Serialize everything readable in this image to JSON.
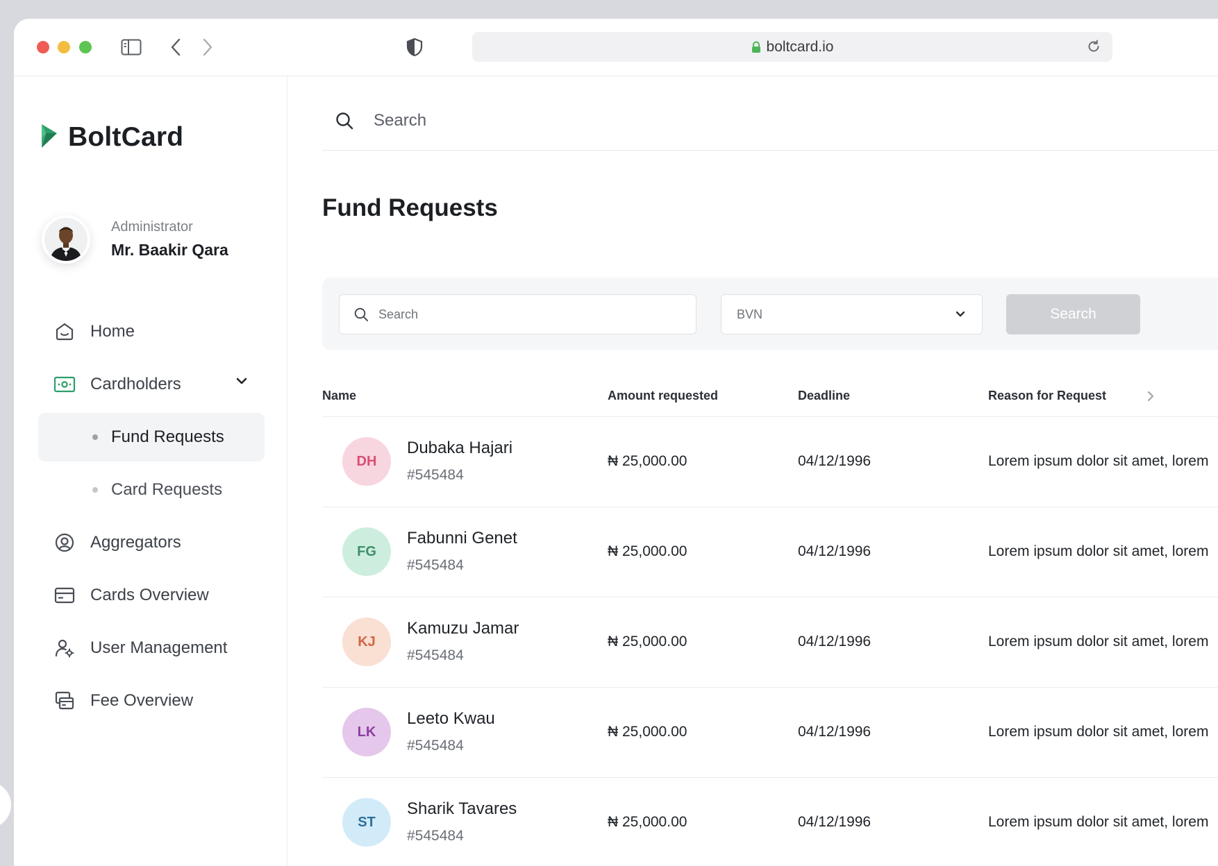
{
  "browser": {
    "url": "boltcard.io"
  },
  "brand": {
    "name": "BoltCard",
    "accent": "#2e9e6b"
  },
  "profile": {
    "role": "Administrator",
    "name": "Mr. Baakir Qara"
  },
  "nav": {
    "home": "Home",
    "cardholders": "Cardholders",
    "fund_requests": "Fund Requests",
    "card_requests": "Card Requests",
    "aggregators": "Aggregators",
    "cards_overview": "Cards Overview",
    "user_management": "User Management",
    "fee_overview": "Fee Overview"
  },
  "topbar": {
    "search_placeholder": "Search"
  },
  "page": {
    "title": "Fund Requests"
  },
  "filters": {
    "search_placeholder": "Search",
    "select_value": "BVN",
    "button_label": "Search"
  },
  "table": {
    "columns": {
      "name": "Name",
      "amount": "Amount requested",
      "deadline": "Deadline",
      "reason": "Reason for Request"
    },
    "rows": [
      {
        "initials": "DH",
        "name": "Dubaka Hajari",
        "id": "#545484",
        "amount": "₦ 25,000.00",
        "deadline": "04/12/1996",
        "reason": "Lorem ipsum dolor sit amet, lorem",
        "avatar_bg": "#f8d6df",
        "avatar_fg": "#d94f74"
      },
      {
        "initials": "FG",
        "name": "Fabunni Genet",
        "id": "#545484",
        "amount": "₦ 25,000.00",
        "deadline": "04/12/1996",
        "reason": "Lorem ipsum dolor sit amet, lorem",
        "avatar_bg": "#cdeede",
        "avatar_fg": "#3f8e68"
      },
      {
        "initials": "KJ",
        "name": "Kamuzu Jamar",
        "id": "#545484",
        "amount": "₦ 25,000.00",
        "deadline": "04/12/1996",
        "reason": "Lorem ipsum dolor sit amet, lorem",
        "avatar_bg": "#fadfd3",
        "avatar_fg": "#cf6742"
      },
      {
        "initials": "LK",
        "name": "Leeto Kwau",
        "id": "#545484",
        "amount": "₦ 25,000.00",
        "deadline": "04/12/1996",
        "reason": "Lorem ipsum dolor sit amet, lorem",
        "avatar_bg": "#e6c7ec",
        "avatar_fg": "#8a3f9f"
      },
      {
        "initials": "ST",
        "name": "Sharik Tavares",
        "id": "#545484",
        "amount": "₦ 25,000.00",
        "deadline": "04/12/1996",
        "reason": "Lorem ipsum dolor sit amet, lorem",
        "avatar_bg": "#d2ebf9",
        "avatar_fg": "#2f6f9a"
      }
    ]
  }
}
